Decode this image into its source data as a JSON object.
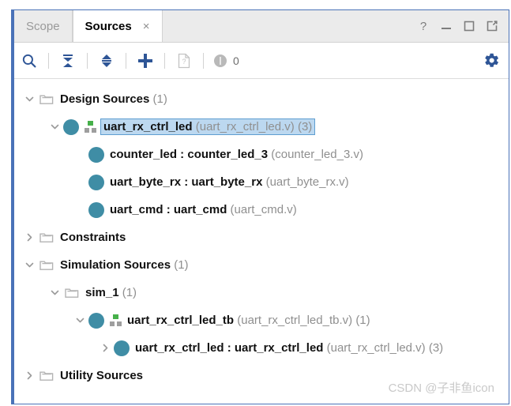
{
  "window": {
    "controls": [
      {
        "name": "help-icon",
        "glyph": "?"
      },
      {
        "name": "minimize-icon",
        "glyph": "—"
      },
      {
        "name": "maximize-icon",
        "glyph": "□"
      },
      {
        "name": "float-icon",
        "glyph": "↗"
      }
    ]
  },
  "tabs": [
    {
      "label": "Scope",
      "active": false,
      "closable": false
    },
    {
      "label": "Sources",
      "active": true,
      "closable": true,
      "close_label": "×"
    }
  ],
  "toolbar": {
    "buttons": [
      {
        "name": "search-icon",
        "label": "Search"
      },
      {
        "name": "collapse-all-icon",
        "label": "Collapse All"
      },
      {
        "name": "expand-all-icon",
        "label": "Expand All"
      },
      {
        "name": "add-sources-icon",
        "label": "Add Sources"
      },
      {
        "name": "report-icon",
        "label": "Report"
      }
    ],
    "message_count": "0",
    "settings_label": "Settings",
    "settings_icon": "gear-icon"
  },
  "tree": {
    "rows": [
      {
        "indent": 0,
        "twisty": "expanded",
        "icon": "folder",
        "name": "Design Sources",
        "suffix": "",
        "count": "(1)",
        "selected": false
      },
      {
        "indent": 1,
        "twisty": "expanded",
        "icon": "module",
        "name": "uart_rx_ctrl_led",
        "suffix": "(uart_rx_ctrl_led.v)",
        "count": "(3)",
        "selected": true
      },
      {
        "indent": 2,
        "twisty": "none",
        "icon": "circle",
        "name": "counter_led : counter_led_3",
        "suffix": "(counter_led_3.v)",
        "count": "",
        "selected": false
      },
      {
        "indent": 2,
        "twisty": "none",
        "icon": "circle",
        "name": "uart_byte_rx : uart_byte_rx",
        "suffix": "(uart_byte_rx.v)",
        "count": "",
        "selected": false
      },
      {
        "indent": 2,
        "twisty": "none",
        "icon": "circle",
        "name": "uart_cmd : uart_cmd",
        "suffix": "(uart_cmd.v)",
        "count": "",
        "selected": false
      },
      {
        "indent": 0,
        "twisty": "collapsed",
        "icon": "folder",
        "name": "Constraints",
        "suffix": "",
        "count": "",
        "selected": false
      },
      {
        "indent": 0,
        "twisty": "expanded",
        "icon": "folder",
        "name": "Simulation Sources",
        "suffix": "",
        "count": "(1)",
        "selected": false
      },
      {
        "indent": 1,
        "twisty": "expanded",
        "icon": "folder",
        "name": "sim_1",
        "suffix": "",
        "count": "(1)",
        "selected": false
      },
      {
        "indent": 2,
        "twisty": "expanded",
        "icon": "module",
        "name": "uart_rx_ctrl_led_tb",
        "suffix": "(uart_rx_ctrl_led_tb.v)",
        "count": "(1)",
        "selected": false
      },
      {
        "indent": 3,
        "twisty": "collapsed",
        "icon": "circle",
        "name": "uart_rx_ctrl_led : uart_rx_ctrl_led",
        "suffix": "(uart_rx_ctrl_led.v)",
        "count": "(3)",
        "selected": false
      },
      {
        "indent": 0,
        "twisty": "collapsed",
        "icon": "folder",
        "name": "Utility Sources",
        "suffix": "",
        "count": "",
        "selected": false
      }
    ]
  },
  "watermark": "CSDN @子非鱼icon",
  "colors": {
    "accent": "#4a72b8",
    "module_circle": "#3f8da5",
    "selection_fill": "#bcd8f0",
    "selection_border": "#5f9ed1",
    "module_green": "#46b04a"
  }
}
